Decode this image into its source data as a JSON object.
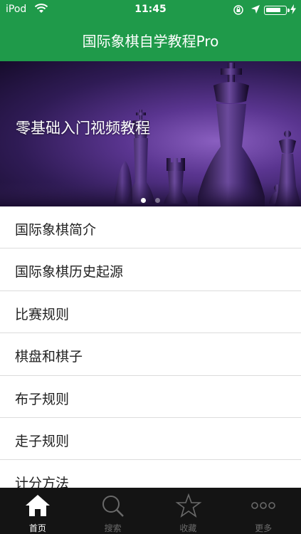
{
  "status_bar": {
    "carrier": "iPod",
    "time": "11:45",
    "battery_level": 0.75
  },
  "nav": {
    "title": "国际象棋自学教程Pro",
    "bar_color": "#1f9a4a"
  },
  "banner": {
    "caption": "零基础入门视频教程",
    "page_count": 2,
    "current_page": 1
  },
  "list": {
    "items": [
      {
        "label": "国际象棋简介"
      },
      {
        "label": "国际象棋历史起源"
      },
      {
        "label": "比赛规则"
      },
      {
        "label": "棋盘和棋子"
      },
      {
        "label": "布子规则"
      },
      {
        "label": "走子规则"
      },
      {
        "label": "计分方法"
      }
    ]
  },
  "tabs": [
    {
      "label": "首页",
      "icon": "home-icon",
      "active": true
    },
    {
      "label": "搜索",
      "icon": "search-icon",
      "active": false
    },
    {
      "label": "收藏",
      "icon": "star-icon",
      "active": false
    },
    {
      "label": "更多",
      "icon": "more-icon",
      "active": false
    }
  ]
}
